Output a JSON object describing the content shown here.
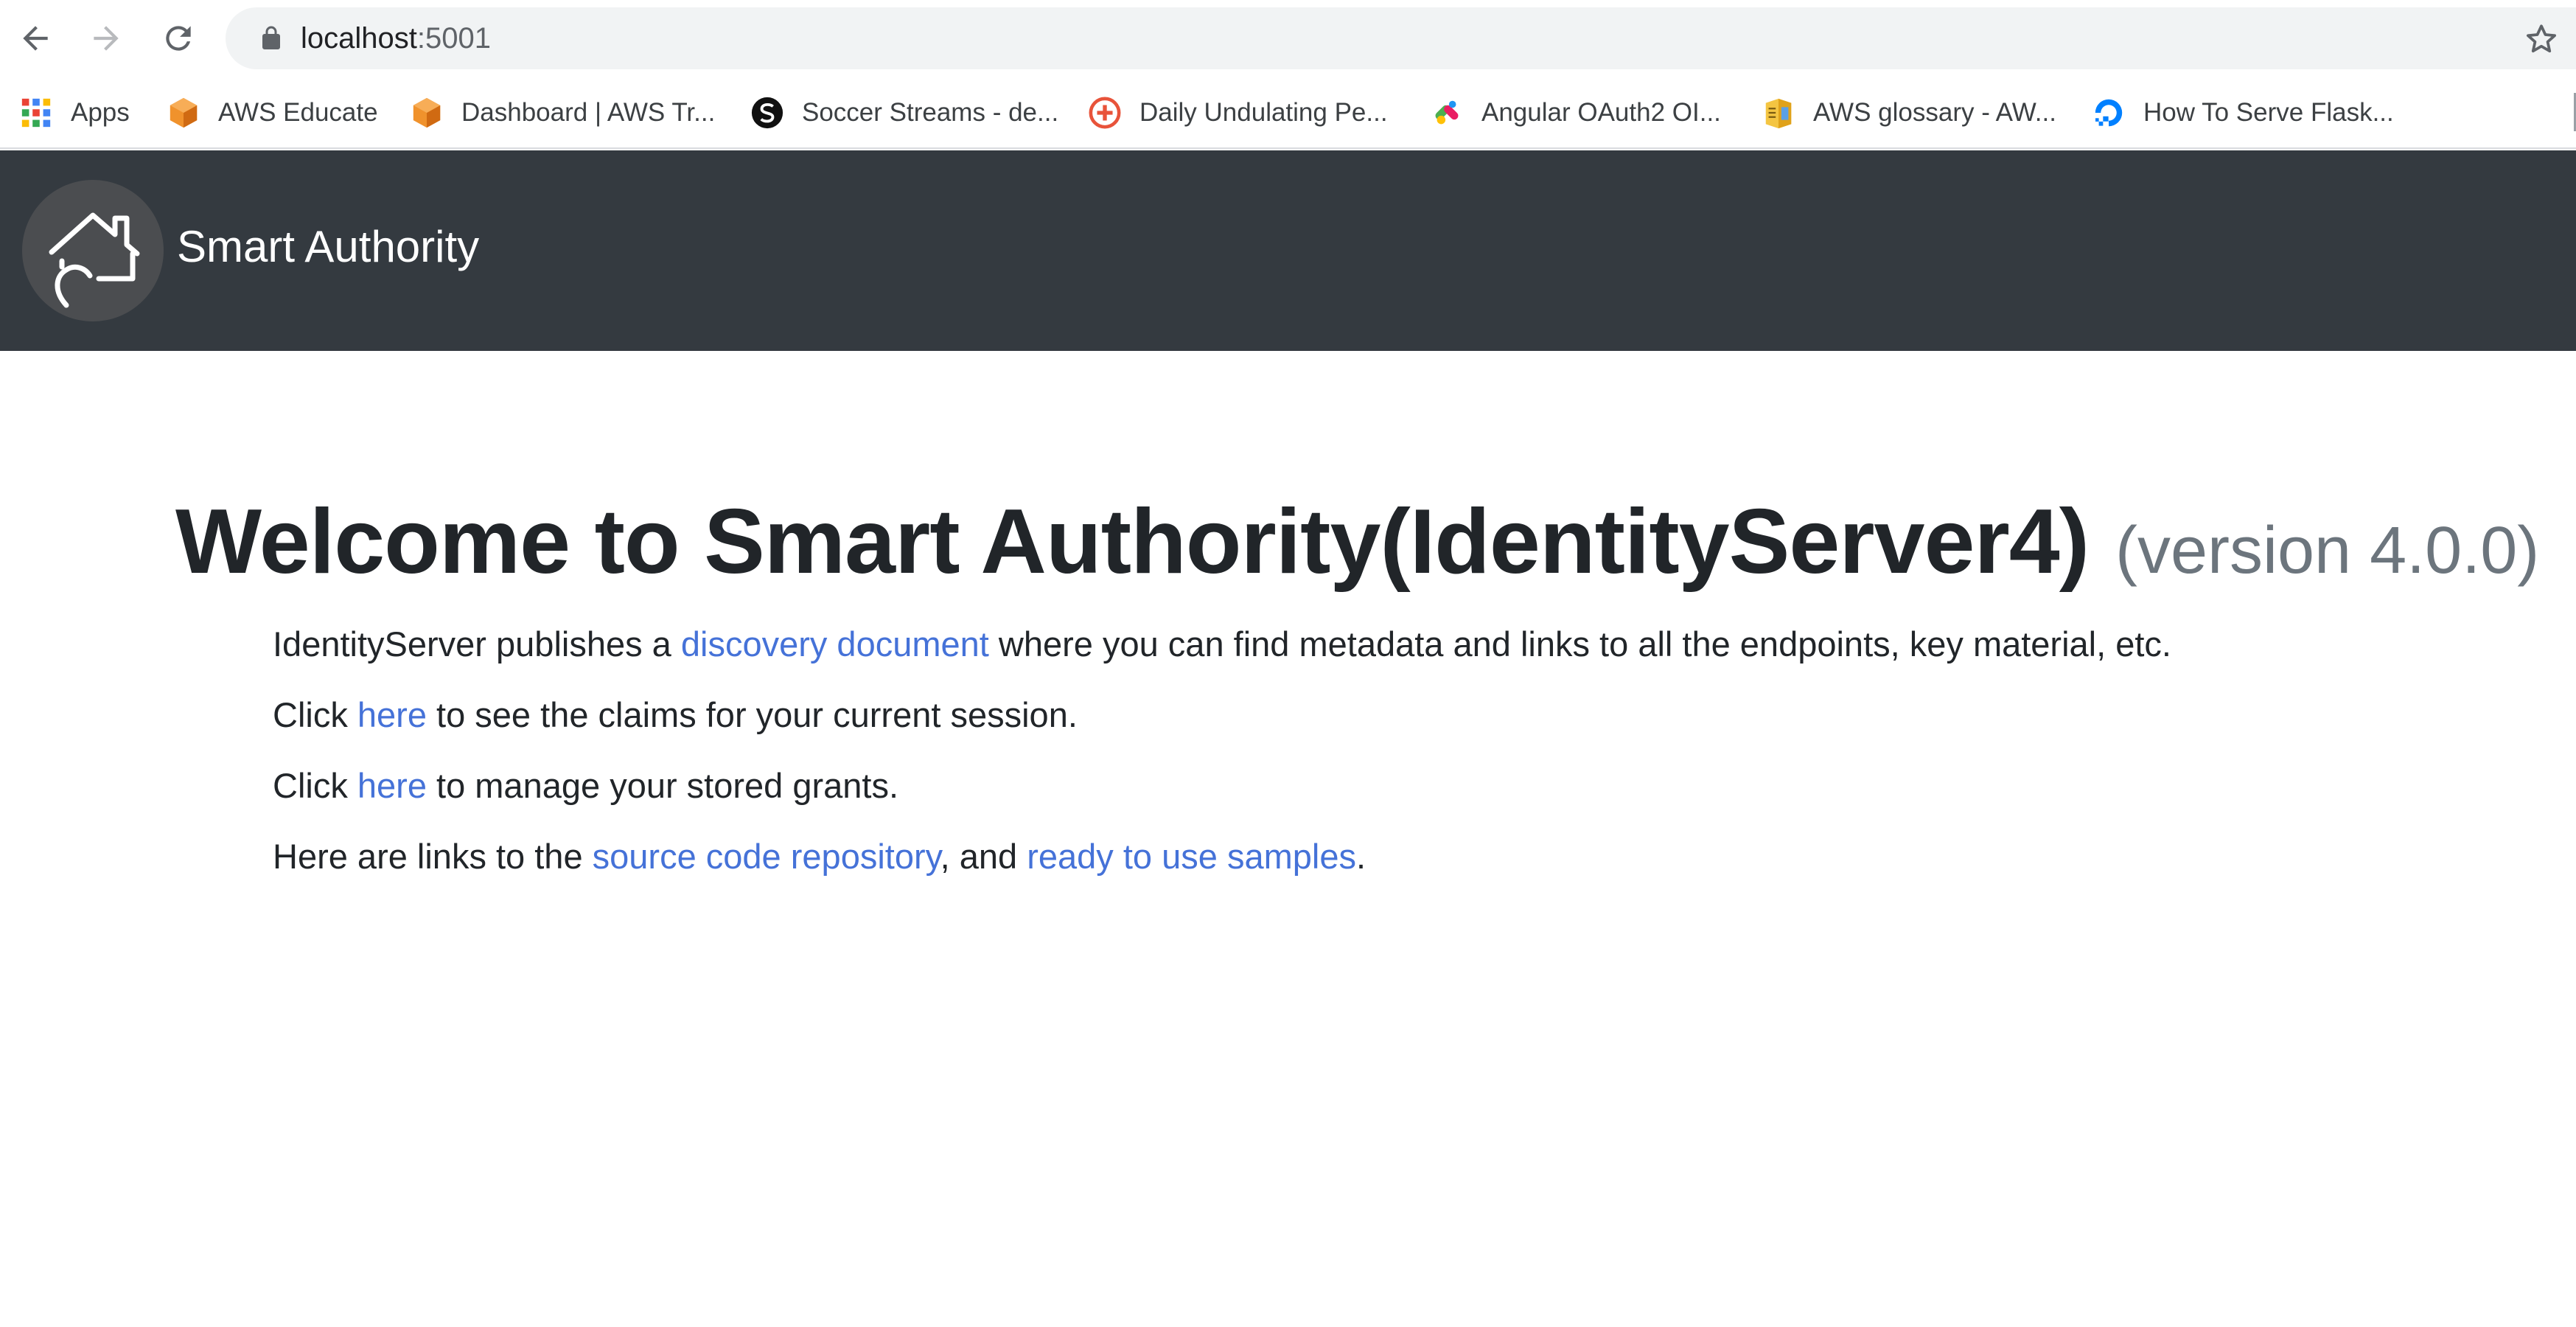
{
  "browser": {
    "url_host": "localhost",
    "url_port": ":5001",
    "bookmarks": [
      {
        "label": "Apps",
        "icon": "apps-grid-icon"
      },
      {
        "label": "AWS Educate",
        "icon": "aws-cube-icon"
      },
      {
        "label": "Dashboard | AWS Tr...",
        "icon": "aws-cube-icon"
      },
      {
        "label": "Soccer Streams - de...",
        "icon": "soccer-streams-icon"
      },
      {
        "label": "Daily Undulating Pe...",
        "icon": "plus-circle-icon"
      },
      {
        "label": "Angular OAuth2 OI...",
        "icon": "angular-oauth-icon"
      },
      {
        "label": "AWS glossary - AW...",
        "icon": "glossary-book-icon"
      },
      {
        "label": "How To Serve Flask...",
        "icon": "digitalocean-icon"
      }
    ]
  },
  "site": {
    "brand": "Smart Authority"
  },
  "main": {
    "title": "Welcome to Smart Authority(IdentityServer4)",
    "version": "(version 4.0.0)",
    "p1": {
      "before": "IdentityServer publishes a ",
      "link": "discovery document",
      "after": " where you can find metadata and links to all the endpoints, key material, etc."
    },
    "p2": {
      "before": "Click ",
      "link": "here",
      "after": " to see the claims for your current session."
    },
    "p3": {
      "before": "Click ",
      "link": "here",
      "after": " to manage your stored grants."
    },
    "p4": {
      "before": "Here are links to the ",
      "link1": "source code repository",
      "mid": ", and ",
      "link2": "ready to use samples",
      "after": "."
    }
  },
  "colors": {
    "navbar_bg": "#343a40",
    "link": "#4572d8",
    "muted": "#6c757d"
  }
}
